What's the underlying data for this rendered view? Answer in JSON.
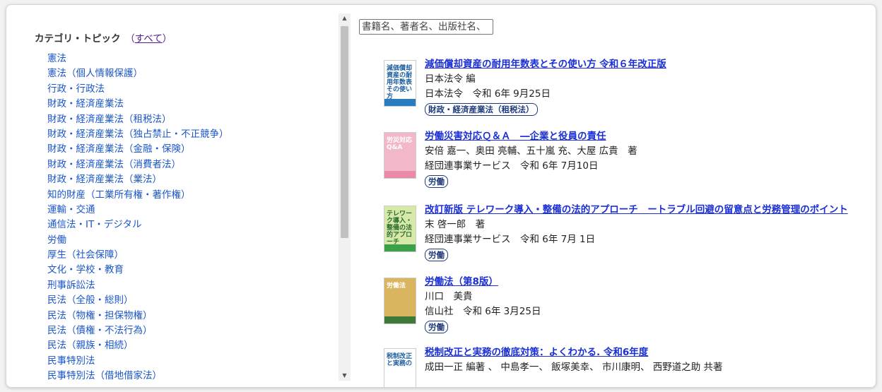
{
  "sidebar": {
    "header": "カテゴリ・トピック",
    "all_link": "すべて",
    "categories": [
      "憲法",
      "憲法（個人情報保護）",
      "行政・行政法",
      "財政・経済産業法",
      "財政・経済産業法（租税法）",
      "財政・経済産業法（独占禁止・不正競争）",
      "財政・経済産業法（金融・保険）",
      "財政・経済産業法（消費者法）",
      "財政・経済産業法（業法）",
      "知的財産（工業所有権・著作権）",
      "運輸・交通",
      "通信法・IT・デジタル",
      "労働",
      "厚生（社会保障）",
      "文化・学校・教育",
      "刑事訴訟法",
      "民法（全般・総則）",
      "民法（物権・担保物権）",
      "民法（債権・不法行為）",
      "民法（親族・相続）",
      "民事特別法",
      "民事特別法（借地借家法）"
    ]
  },
  "search": {
    "placeholder": "書籍名、著者名、出版社名、"
  },
  "books": [
    {
      "title": "減価償却資産の耐用年数表とその使い方 令和６年改正版",
      "author": "日本法令 編",
      "publisher_date": "日本法令　令和 6年 9月25日",
      "tag": "財政・経済産業法（租税法）",
      "cover_text": "減価償却資産の耐用年数表その使い方",
      "cover_bg": "#ffffff",
      "cover_band": "#2b7bbf",
      "cover_fg": "#1d5ea0"
    },
    {
      "title": "労働災害対応Ｑ＆Ａ　―企業と役員の責任",
      "author": "安倍 嘉一、奥田 亮輔、五十嵐 充、大屋 広貴　著",
      "publisher_date": "経団連事業サービス　令和 6年 7月10日",
      "tag": "労働",
      "cover_text": "労災対応Q&A",
      "cover_bg": "#f3b8c8",
      "cover_band": "#e98aa6",
      "cover_fg": "#ffffff"
    },
    {
      "title": "改訂新版 テレワーク導入・整備の法的アプローチ　ートラブル回避の留意点と労務管理のポイント",
      "author": "末 啓一郎　著",
      "publisher_date": "経団連事業サービス　令和 6年 7月 1日",
      "tag": "労働",
      "cover_text": "テレワーク導入・整備の法的アプローチ",
      "cover_bg": "#d7e9a8",
      "cover_band": "#3aa14a",
      "cover_fg": "#2a6a2f"
    },
    {
      "title": "労働法（第8版）",
      "author": "川口　美貴",
      "publisher_date": "信山社　令和 6年 3月25日",
      "tag": "労働",
      "cover_text": "労働法",
      "cover_bg": "#d9b560",
      "cover_band": "#3f7a3a",
      "cover_fg": "#ffffff"
    },
    {
      "title": "税制改正と実務の徹底対策：よくわかる. 令和6年度",
      "author": "成田一正 編著 、 中島孝一、 飯塚美幸、 市川康明、 西野道之助 共著",
      "publisher_date": "",
      "tag": "",
      "cover_text": "税制改正と実務の",
      "cover_bg": "#ffffff",
      "cover_band": "#1d9a4a",
      "cover_fg": "#1d5ea0"
    }
  ]
}
